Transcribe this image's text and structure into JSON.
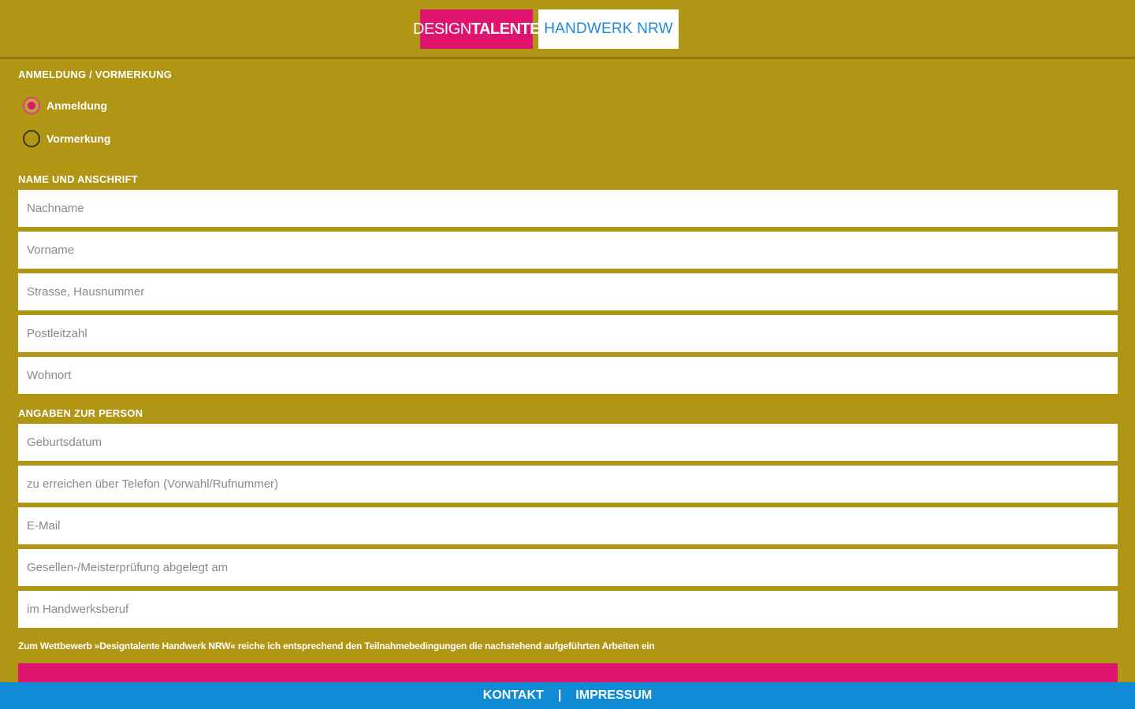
{
  "header": {
    "logo_left_light": "DESIGN",
    "logo_left_bold": "TALENTE",
    "logo_right": "HANDWERK NRW"
  },
  "registration": {
    "title": "ANMELDUNG / VORMERKUNG",
    "options": [
      {
        "label": "Anmeldung",
        "checked": true
      },
      {
        "label": "Vormerkung",
        "checked": false
      }
    ]
  },
  "address": {
    "title": "NAME UND ANSCHRIFT",
    "fields": [
      {
        "placeholder": "Nachname",
        "value": ""
      },
      {
        "placeholder": "Vorname",
        "value": ""
      },
      {
        "placeholder": "Strasse, Hausnummer",
        "value": ""
      },
      {
        "placeholder": "Postleitzahl",
        "value": ""
      },
      {
        "placeholder": "Wohnort",
        "value": ""
      }
    ]
  },
  "person": {
    "title": "ANGABEN ZUR PERSON",
    "fields": [
      {
        "placeholder": "Geburtsdatum",
        "value": ""
      },
      {
        "placeholder": "zu erreichen über Telefon (Vorwahl/Rufnummer)",
        "value": ""
      },
      {
        "placeholder": "E-Mail",
        "value": ""
      },
      {
        "placeholder": "Gesellen-/Meisterprüfung abgelegt am",
        "value": ""
      },
      {
        "placeholder": "im Handwerksberuf",
        "value": ""
      }
    ]
  },
  "consent_text": "Zum Wettbewerb »Designtalente Handwerk NRW« reiche ich entsprechend den Teilnahmebedingungen die nachstehend aufgeführten Arbeiten ein",
  "footer": {
    "contact": "KONTAKT",
    "separator": "|",
    "imprint": "IMPRESSUM"
  },
  "colors": {
    "background": "#b09614",
    "brand_pink": "#e0146e",
    "brand_blue": "#118bd3"
  }
}
